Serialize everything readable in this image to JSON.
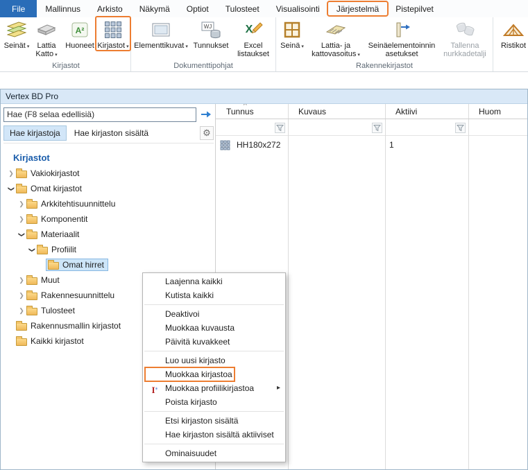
{
  "colors": {
    "annotation": "#ed7d31",
    "file_tab_blue": "#2a6db8",
    "selection_blue": "#cde5f8",
    "heading_blue": "#1a5dab"
  },
  "icons": {
    "dropdown_caret": "▾",
    "gear": "⚙",
    "sort_caret": "^",
    "submenu_arrow": "▸",
    "tree_chevron": "❯",
    "a2_badge": "A²",
    "wj_badge": "WJ",
    "excel_x": "X",
    "profile_i": "I",
    "profile_star": "⁎"
  },
  "ribbon": {
    "tabs": [
      "File",
      "Mallinnus",
      "Arkisto",
      "Näkymä",
      "Optiot",
      "Tulosteet",
      "Visualisointi",
      "Järjestelmä",
      "Pistepilvet"
    ],
    "annotated_tab": "Järjestelmä",
    "groups": [
      {
        "label": "Kirjastot",
        "buttons": [
          {
            "label": "Seinät",
            "dropdown": true
          },
          {
            "label": "Lattia Katto",
            "dropdown": true
          },
          {
            "label": "Huoneet",
            "dropdown": false
          },
          {
            "label": "Kirjastot",
            "dropdown": true,
            "annotated": true
          }
        ]
      },
      {
        "label": "Dokumenttipohjat",
        "buttons": [
          {
            "label": "Elementtikuvat",
            "dropdown": true
          },
          {
            "label": "Tunnukset",
            "dropdown": false
          },
          {
            "label": "Excel listaukset",
            "dropdown": false
          }
        ]
      },
      {
        "label": "Rakennekirjastot",
        "buttons": [
          {
            "label": "Seinä",
            "dropdown": true
          },
          {
            "label": "Lattia- ja kattovasoitus",
            "dropdown": true
          },
          {
            "label": "Seinäelementoinnin asetukset",
            "dropdown": false
          },
          {
            "label": "Tallenna nurkkadetalji",
            "dropdown": false,
            "disabled": true
          }
        ]
      },
      {
        "label": "",
        "buttons": [
          {
            "label": "Ristikot",
            "dropdown": false
          }
        ]
      }
    ]
  },
  "window": {
    "title": "Vertex BD Pro",
    "search": {
      "value": "Hae (F8 selaa edellisiä)"
    },
    "tabs": [
      "Hae kirjastoja",
      "Hae kirjaston sisältä"
    ],
    "active_tab": "Hae kirjastoja",
    "tree": {
      "heading": "Kirjastot",
      "items": [
        {
          "label": "Vakiokirjastot",
          "level": 0,
          "state": "collapsed"
        },
        {
          "label": "Omat kirjastot",
          "level": 0,
          "state": "expanded"
        },
        {
          "label": "Arkkitehtisuunnittelu",
          "level": 1,
          "state": "collapsed"
        },
        {
          "label": "Komponentit",
          "level": 1,
          "state": "collapsed"
        },
        {
          "label": "Materiaalit",
          "level": 1,
          "state": "expanded"
        },
        {
          "label": "Profiilit",
          "level": 2,
          "state": "expanded"
        },
        {
          "label": "Omat hirret",
          "level": 3,
          "state": "leaf",
          "selected": true
        },
        {
          "label": "Muut",
          "level": 1,
          "state": "collapsed"
        },
        {
          "label": "Rakennesuunnittelu",
          "level": 1,
          "state": "collapsed"
        },
        {
          "label": "Tulosteet",
          "level": 1,
          "state": "collapsed"
        },
        {
          "label": "Rakennusmallin kirjastot",
          "level": 0,
          "state": "leaf"
        },
        {
          "label": "Kaikki kirjastot",
          "level": 0,
          "state": "leaf"
        }
      ]
    }
  },
  "table": {
    "columns": [
      "Tunnus",
      "Kuvaus",
      "Aktiivi",
      "Huom"
    ],
    "sort": {
      "column": "Tunnus",
      "direction": "asc"
    },
    "rows": [
      {
        "tunnus": "HH180x272",
        "kuvaus": "",
        "aktiivi": "1",
        "huom": ""
      }
    ]
  },
  "context_menu": {
    "items": [
      "Laajenna kaikki",
      "Kutista kaikki",
      "Deaktivoi",
      "Muokkaa kuvausta",
      "Päivitä kuvakkeet",
      "Luo uusi kirjasto",
      "Muokkaa kirjastoa",
      "Muokkaa profiilikirjastoa",
      "Poista kirjasto",
      "Etsi kirjaston sisältä",
      "Hae kirjaston sisältä aktiiviset",
      "Ominaisuudet"
    ],
    "annotated_item": "Muokkaa kirjastoa"
  }
}
